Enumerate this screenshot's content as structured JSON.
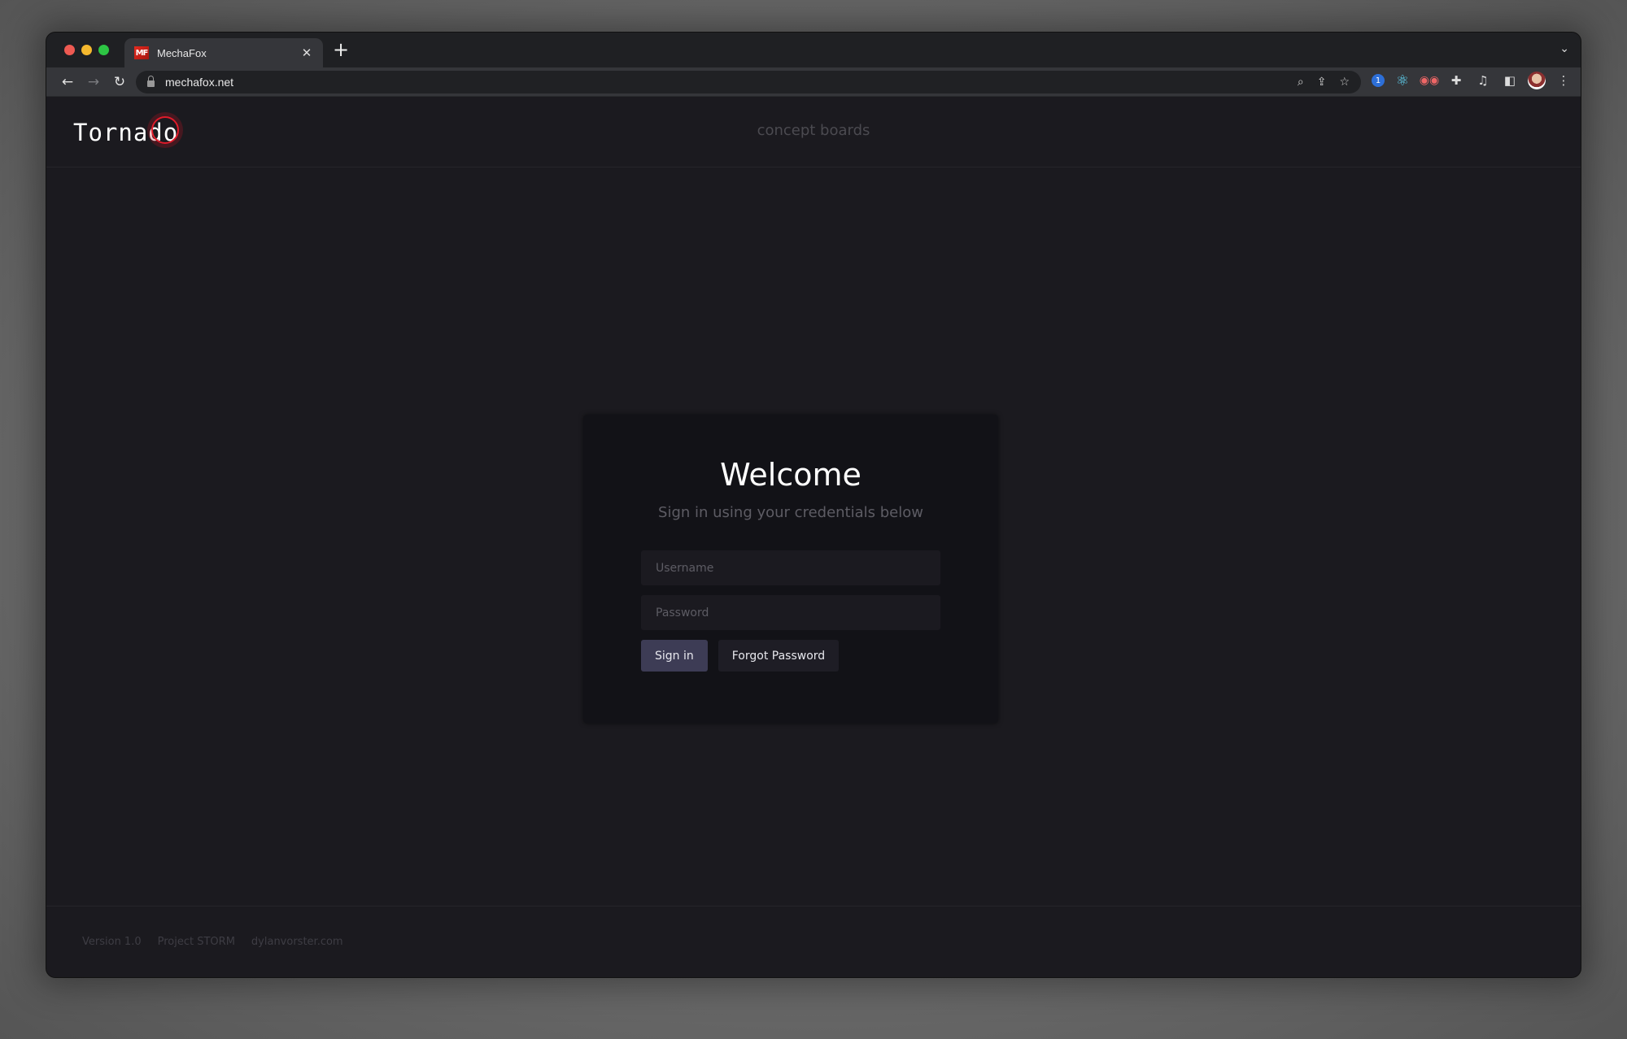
{
  "browser": {
    "tab": {
      "favicon_text": "MF",
      "title": "MechaFox",
      "close_icon": "✕"
    },
    "new_tab_icon": "+",
    "tab_dropdown_icon": "⌄",
    "nav": {
      "back_icon": "←",
      "forward_icon": "→",
      "reload_icon": "↻"
    },
    "url": "mechafox.net",
    "omnibox_icons": {
      "search": "⌕",
      "share": "⇪",
      "bookmark": "☆"
    },
    "extensions": [
      {
        "name": "1password-icon",
        "glyph": "1"
      },
      {
        "name": "react-devtools-icon",
        "glyph": "⚛"
      },
      {
        "name": "spy-extension-icon",
        "glyph": "◉◉"
      },
      {
        "name": "extensions-puzzle-icon",
        "glyph": "✚"
      },
      {
        "name": "media-queue-icon",
        "glyph": "♫"
      },
      {
        "name": "side-panel-icon",
        "glyph": "◧"
      }
    ],
    "menu_icon": "⋮"
  },
  "header": {
    "logo": "Tornado",
    "tagline": "concept boards"
  },
  "login": {
    "title": "Welcome",
    "subtitle": "Sign in using your credentials below",
    "username": {
      "value": "",
      "placeholder": "Username"
    },
    "password": {
      "value": "",
      "placeholder": "Password"
    },
    "sign_in_label": "Sign in",
    "forgot_password_label": "Forgot Password"
  },
  "footer": {
    "links": [
      "Version 1.0",
      "Project STORM",
      "dylanvorster.com"
    ]
  },
  "colors": {
    "brand_accent": "#e01b2a",
    "primary_button": "#3d3c55",
    "page_background": "#1b1a1f",
    "card_background": "#121217"
  }
}
